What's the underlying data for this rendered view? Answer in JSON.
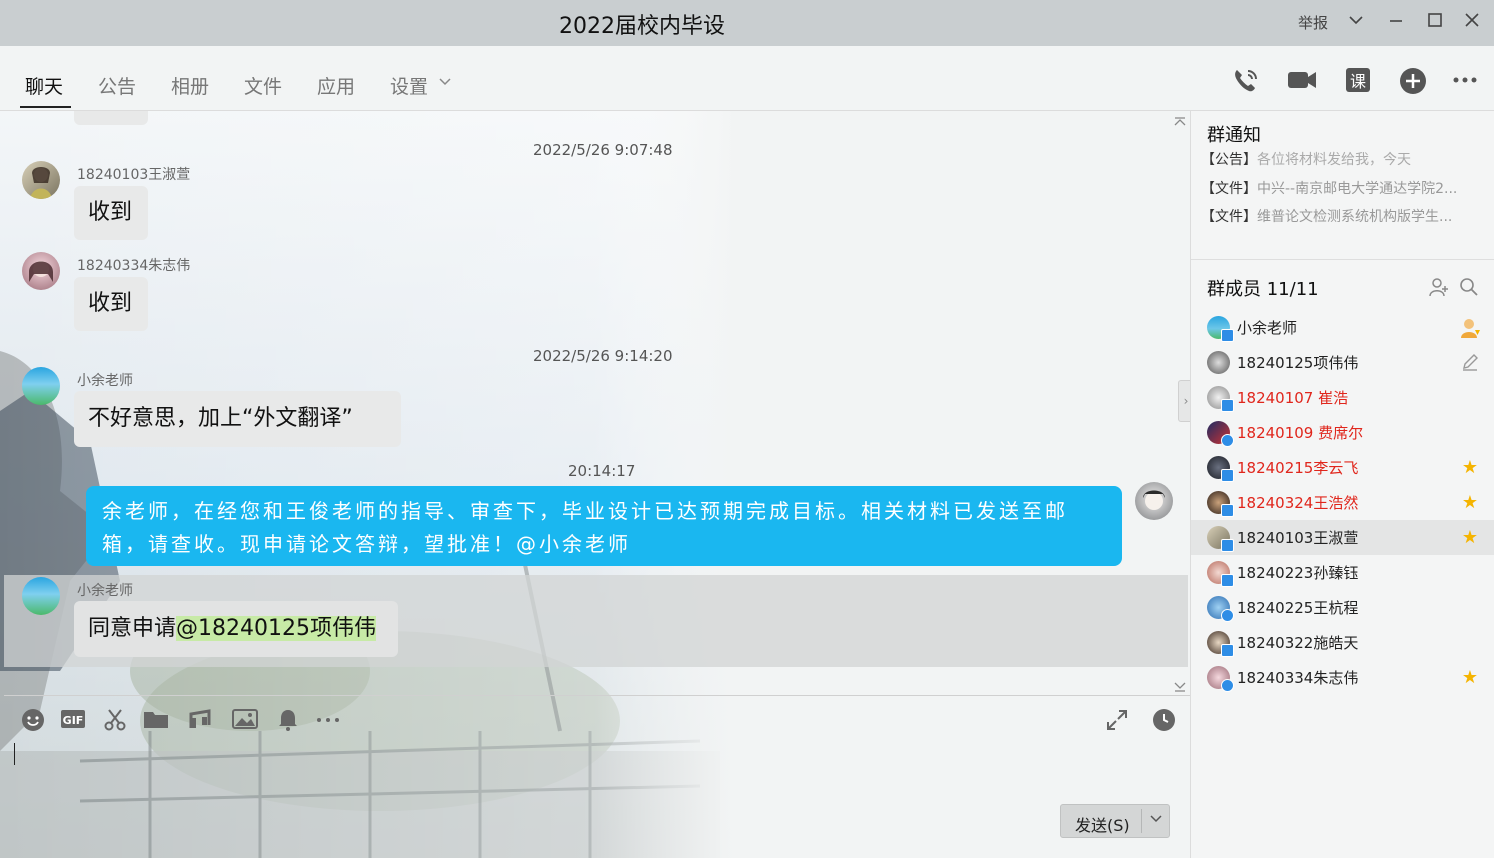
{
  "window": {
    "title": "2022届校内毕设",
    "report": "举报"
  },
  "tabs": [
    "聊天",
    "公告",
    "相册",
    "文件",
    "应用",
    "设置"
  ],
  "messages": {
    "ts1": "2022/5/26 9:07:48",
    "m1_name": "18240103王淑萱",
    "m1_text": "收到",
    "m2_name": "18240334朱志伟",
    "m2_text": "收到",
    "ts2": "2022/5/26 9:14:20",
    "m3_name": "小余老师",
    "m3_text": "不好意思，加上“外文翻译”",
    "ts3": "20:14:17",
    "me_line1": "余老师，在经您和王俊老师的指导、审查下，毕业设计已达预期完成目标。相关材料已发送至邮",
    "me_line2": "箱，请查收。现申请论文答辩，望批准！@小余老师",
    "m4_name": "小余老师",
    "m4_text": "同意申请",
    "m4_mention": "@18240125项伟伟"
  },
  "input": {
    "send_label": "发送(S)"
  },
  "right": {
    "notice_title": "群通知",
    "notices": [
      {
        "tag": "【公告】",
        "text": "各位将材料发给我，今天"
      },
      {
        "tag": "【文件】",
        "text": "中兴--南京邮电大学通达学院2..."
      },
      {
        "tag": "【文件】",
        "text": "维普论文检测系统机构版学生..."
      }
    ],
    "members_title": "群成员 11/11",
    "members": [
      {
        "name": "小余老师"
      },
      {
        "name": "18240125项伟伟"
      },
      {
        "name": "18240107 崔浩"
      },
      {
        "name": "18240109 费席尔"
      },
      {
        "name": "18240215李云飞"
      },
      {
        "name": "18240324王浩然"
      },
      {
        "name": "18240103王淑萱"
      },
      {
        "name": "18240223孙臻钰"
      },
      {
        "name": "18240225王杭程"
      },
      {
        "name": "18240322施皓天"
      },
      {
        "name": "18240334朱志伟"
      }
    ]
  }
}
